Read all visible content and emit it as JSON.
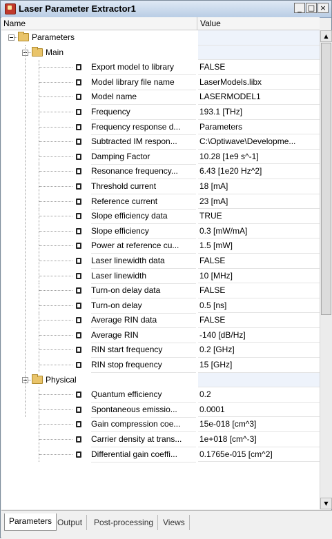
{
  "window": {
    "title": "Laser Parameter Extractor1",
    "minimize": "_",
    "maximize": "□",
    "close": "×"
  },
  "columns": {
    "name": "Name",
    "value": "Value"
  },
  "tree": [
    {
      "kind": "group",
      "level": 0,
      "name": "Parameters",
      "value": ""
    },
    {
      "kind": "group",
      "level": 1,
      "name": "Main",
      "value": ""
    },
    {
      "kind": "leaf",
      "name": "Export model to library",
      "value": "FALSE"
    },
    {
      "kind": "leaf",
      "name": "Model library file name",
      "value": "LaserModels.libx"
    },
    {
      "kind": "leaf",
      "name": "Model name",
      "value": "LASERMODEL1"
    },
    {
      "kind": "leaf",
      "name": "Frequency",
      "value": "193.1 [THz]"
    },
    {
      "kind": "leaf",
      "name": "Frequency response d...",
      "value": "Parameters"
    },
    {
      "kind": "leaf",
      "name": "Subtracted IM respon...",
      "value": "C:\\Optiwave\\Developme..."
    },
    {
      "kind": "leaf",
      "name": "Damping Factor",
      "value": "10.28 [1e9 s^-1]"
    },
    {
      "kind": "leaf",
      "name": "Resonance frequency...",
      "value": "6.43 [1e20 Hz^2]"
    },
    {
      "kind": "leaf",
      "name": "Threshold current",
      "value": "18 [mA]"
    },
    {
      "kind": "leaf",
      "name": "Reference current",
      "value": "23 [mA]"
    },
    {
      "kind": "leaf",
      "name": "Slope efficiency data",
      "value": "TRUE"
    },
    {
      "kind": "leaf",
      "name": "Slope efficiency",
      "value": "0.3 [mW/mA]"
    },
    {
      "kind": "leaf",
      "name": "Power at reference cu...",
      "value": "1.5 [mW]"
    },
    {
      "kind": "leaf",
      "name": "Laser linewidth data",
      "value": "FALSE"
    },
    {
      "kind": "leaf",
      "name": "Laser linewidth",
      "value": "10 [MHz]"
    },
    {
      "kind": "leaf",
      "name": "Turn-on delay data",
      "value": "FALSE"
    },
    {
      "kind": "leaf",
      "name": "Turn-on delay",
      "value": "0.5 [ns]"
    },
    {
      "kind": "leaf",
      "name": "Average RIN data",
      "value": "FALSE"
    },
    {
      "kind": "leaf",
      "name": "Average RIN",
      "value": "-140 [dB/Hz]"
    },
    {
      "kind": "leaf",
      "name": "RIN start frequency",
      "value": "0.2 [GHz]"
    },
    {
      "kind": "leaf",
      "name": "RIN stop frequency",
      "value": "15 [GHz]"
    },
    {
      "kind": "group",
      "level": 1,
      "name": "Physical",
      "value": ""
    },
    {
      "kind": "leaf",
      "name": "Quantum efficiency",
      "value": "0.2"
    },
    {
      "kind": "leaf",
      "name": "Spontaneous emissio...",
      "value": "0.0001"
    },
    {
      "kind": "leaf",
      "name": "Gain compression coe...",
      "value": "15e-018 [cm^3]"
    },
    {
      "kind": "leaf",
      "name": "Carrier density at trans...",
      "value": "1e+018 [cm^-3]"
    },
    {
      "kind": "leaf",
      "name": "Differential gain coeffi...",
      "value": "0.1765e-015 [cm^2]"
    }
  ],
  "scrollbar": {
    "up_arrow": "▲",
    "down_arrow": "▼"
  },
  "tabs": [
    "Parameters",
    "Output",
    "Post-processing",
    "Views"
  ],
  "active_tab": "Parameters"
}
